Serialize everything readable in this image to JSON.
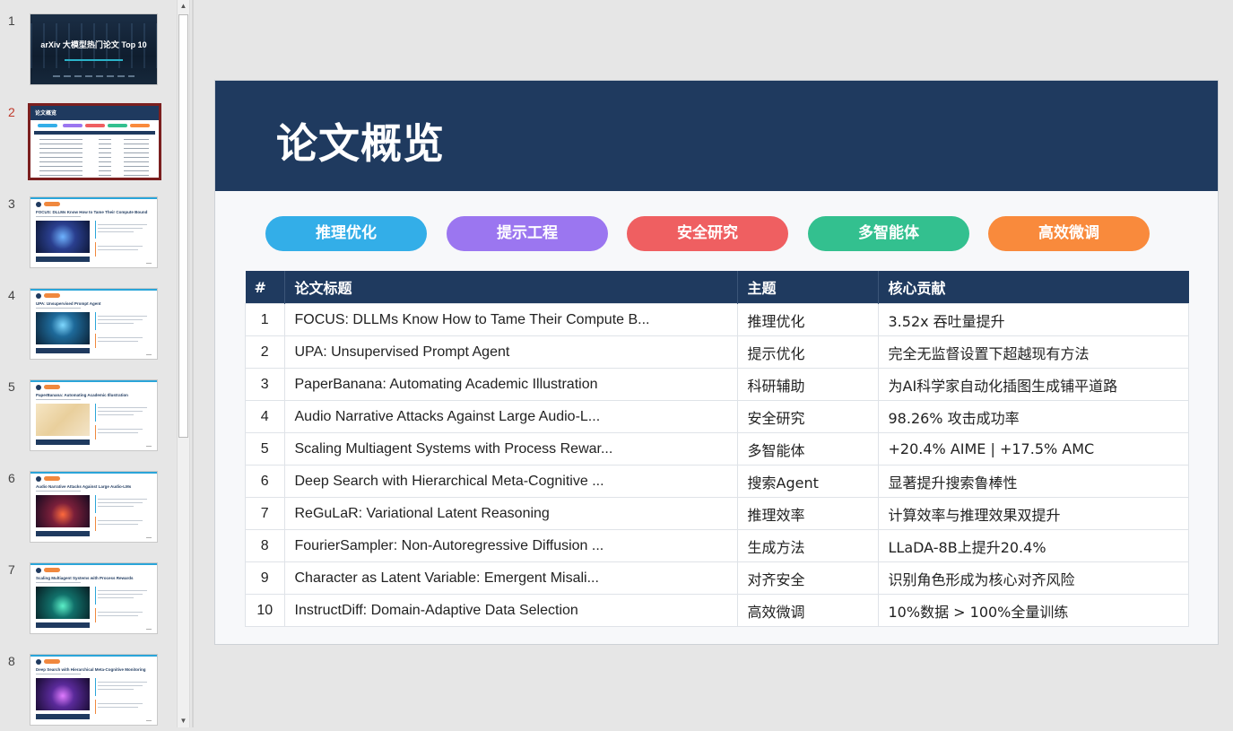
{
  "thumbnails": [
    {
      "number": "1",
      "title": "arXiv 大模型热门论文 Top 10"
    },
    {
      "number": "2",
      "title": "论文概览"
    },
    {
      "number": "3",
      "title": "FOCUS: DLLMs Know How to Tame Their Compute Bound"
    },
    {
      "number": "4",
      "title": "UPA: Unsupervised Prompt Agent"
    },
    {
      "number": "5",
      "title": "PaperBanana: Automating Academic Illustration"
    },
    {
      "number": "6",
      "title": "Audio Narrative Attacks Against Large Audio-LMs"
    },
    {
      "number": "7",
      "title": "Scaling Multiagent Systems with Process Rewards"
    },
    {
      "number": "8",
      "title": "Deep Search with Hierarchical Meta-Cognitive Monitoring"
    }
  ],
  "slide": {
    "title": "论文概览",
    "pills": [
      {
        "label": "推理优化",
        "color": "#33aee8"
      },
      {
        "label": "提示工程",
        "color": "#9b76f0"
      },
      {
        "label": "安全研究",
        "color": "#ef5f61"
      },
      {
        "label": "多智能体",
        "color": "#33c08f"
      },
      {
        "label": "高效微调",
        "color": "#f98a3c"
      }
    ],
    "table": {
      "headers": {
        "num": "#",
        "title": "论文标题",
        "topic": "主题",
        "contribution": "核心贡献"
      },
      "rows": [
        {
          "num": "1",
          "title": "FOCUS: DLLMs Know How to Tame Their Compute B...",
          "topic": "推理优化",
          "contribution": "3.52x 吞吐量提升"
        },
        {
          "num": "2",
          "title": "UPA: Unsupervised Prompt Agent",
          "topic": "提示优化",
          "contribution": "完全无监督设置下超越现有方法"
        },
        {
          "num": "3",
          "title": "PaperBanana: Automating Academic Illustration",
          "topic": "科研辅助",
          "contribution": "为AI科学家自动化插图生成铺平道路"
        },
        {
          "num": "4",
          "title": "Audio Narrative Attacks Against Large Audio-L...",
          "topic": "安全研究",
          "contribution": "98.26% 攻击成功率"
        },
        {
          "num": "5",
          "title": "Scaling Multiagent Systems with Process Rewar...",
          "topic": "多智能体",
          "contribution": "+20.4% AIME | +17.5% AMC"
        },
        {
          "num": "6",
          "title": "Deep Search with Hierarchical Meta-Cognitive ...",
          "topic": "搜索Agent",
          "contribution": "显著提升搜索鲁棒性"
        },
        {
          "num": "7",
          "title": "ReGuLaR: Variational Latent Reasoning",
          "topic": "推理效率",
          "contribution": "计算效率与推理效果双提升"
        },
        {
          "num": "8",
          "title": "FourierSampler: Non-Autoregressive Diffusion ...",
          "topic": "生成方法",
          "contribution": "LLaDA-8B上提升20.4%"
        },
        {
          "num": "9",
          "title": "Character as Latent Variable: Emergent Misali...",
          "topic": "对齐安全",
          "contribution": "识别角色形成为核心对齐风险"
        },
        {
          "num": "10",
          "title": "InstructDiff: Domain-Adaptive Data Selection",
          "topic": "高效微调",
          "contribution": "10%数据 > 100%全量训练"
        }
      ]
    }
  },
  "scrollbar": {
    "up_icon": "triangle-up-icon",
    "down_icon": "triangle-down-icon"
  }
}
